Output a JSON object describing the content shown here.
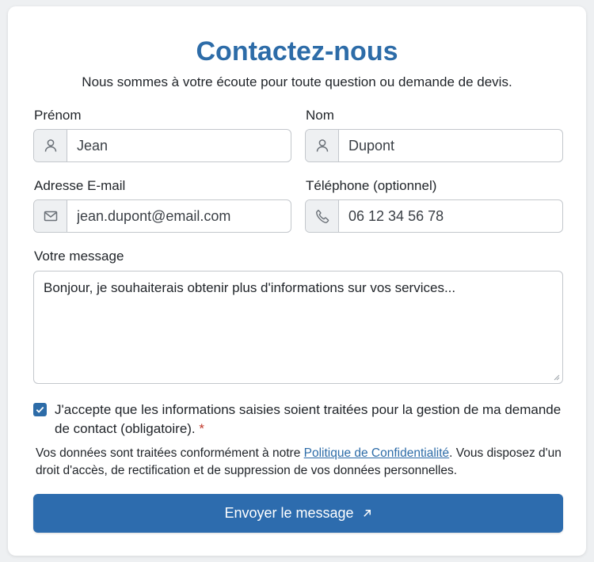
{
  "form": {
    "title": "Contactez-nous",
    "subtitle": "Nous sommes à votre écoute pour toute question ou demande de devis.",
    "fields": {
      "first_name": {
        "label": "Prénom",
        "value": "Jean",
        "icon": "user-icon"
      },
      "last_name": {
        "label": "Nom",
        "value": "Dupont",
        "icon": "user-icon"
      },
      "email": {
        "label": "Adresse E-mail",
        "value": "jean.dupont@email.com",
        "icon": "mail-icon"
      },
      "phone": {
        "label": "Téléphone (optionnel)",
        "value": "06 12 34 56 78",
        "icon": "phone-icon"
      },
      "message": {
        "label": "Votre message",
        "value": "Bonjour, je souhaiterais obtenir plus d'informations sur vos services..."
      }
    },
    "consent": {
      "checked": true,
      "text": "J'accepte que les informations saisies soient traitées pour la gestion de ma demande de contact (obligatoire).",
      "required_mark": "*"
    },
    "privacy": {
      "before": "Vos données sont traitées conformément à notre ",
      "link": "Politique de Confidentialité",
      "after": ". Vous disposez d'un droit d'accès, de rectification et de suppression de vos données personnelles."
    },
    "submit_label": "Envoyer le message",
    "colors": {
      "accent": "#2d6ca8",
      "required": "#c0392b",
      "addon_bg": "#eef0f2"
    }
  }
}
